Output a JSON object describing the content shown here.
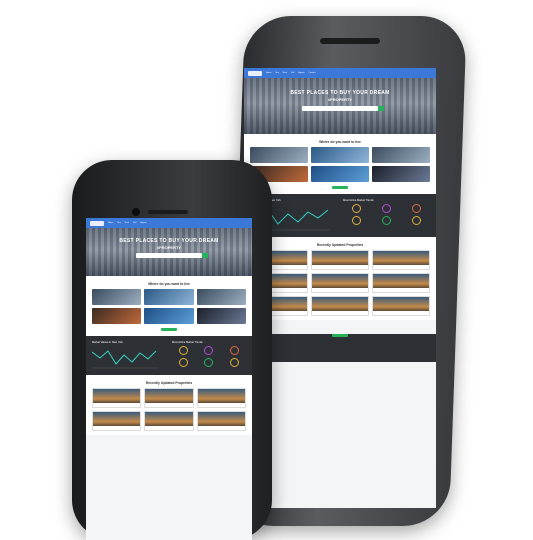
{
  "site": {
    "hero_title": "BEST PLACES TO BUY YOUR DREAM",
    "hero_subtitle": "#PROPERTY",
    "where_title": "Where do you want to live",
    "market_title": "Market Values in New York",
    "trends_title": "Most Active Market Trends",
    "recent_title": "Recently Updated Properties",
    "nav_items": [
      "Home",
      "Buy",
      "Rent",
      "Sell",
      "Agents",
      "Contact"
    ]
  },
  "colors": {
    "nav_blue": "#3b78d8",
    "accent_green": "#25b35a",
    "dark_section": "#2d3035",
    "ring_colors": [
      "#e0b13a",
      "#b34ad8",
      "#e06a3a",
      "#e0b13a",
      "#25b35a",
      "#e0b13a"
    ]
  }
}
